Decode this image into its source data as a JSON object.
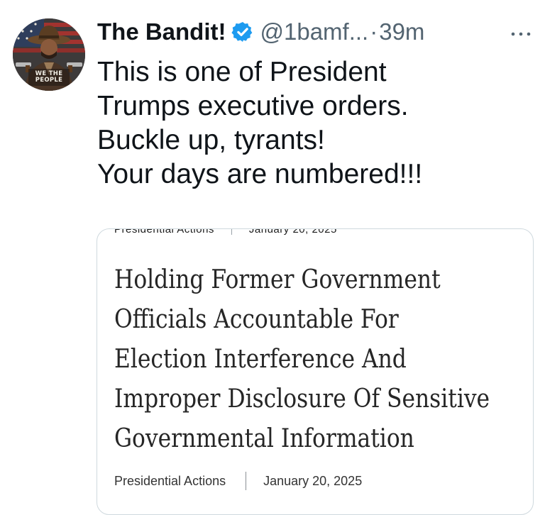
{
  "author": {
    "display_name": "The Bandit!",
    "handle": "@1bamf...",
    "separator": "·",
    "timestamp": "39m",
    "avatar_caption_line1": "WE THE",
    "avatar_caption_line2": "PEOPLE"
  },
  "tweet": {
    "lines": [
      "This is one of President",
      "Trumps executive orders.",
      "Buckle up, tyrants!",
      "Your days are numbered!!!"
    ]
  },
  "card": {
    "category": "Presidential Actions",
    "date": "January 20, 2025",
    "title_lines": [
      "Holding Former Government",
      "Officials Accountable For",
      "Election Interference And",
      "Improper Disclosure Of Sensitive",
      "Governmental Information"
    ]
  },
  "colors": {
    "verified_badge": "#1d9bf0",
    "secondary_text": "#536471",
    "card_border": "#cfd9de"
  },
  "icons": {
    "verified": "verified-badge-icon",
    "more": "more-options-icon"
  }
}
